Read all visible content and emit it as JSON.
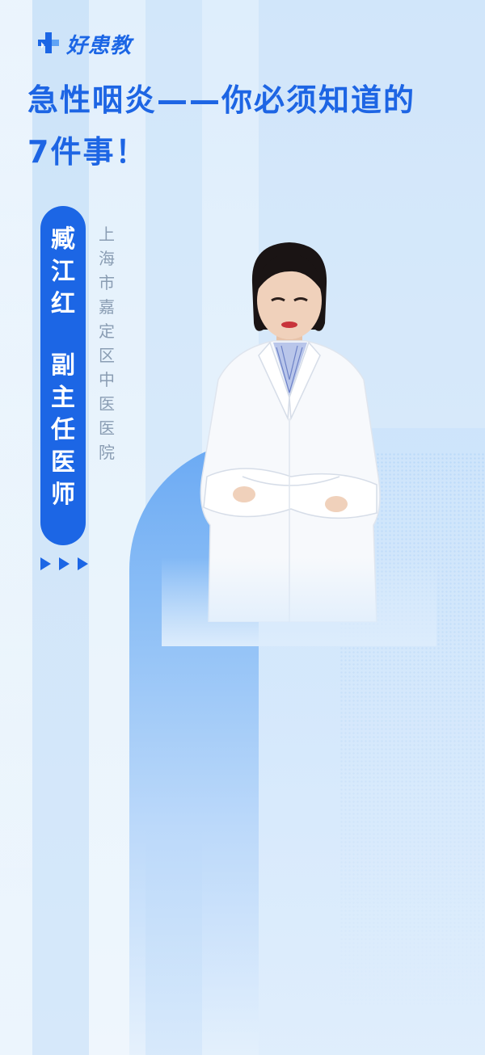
{
  "brand": {
    "logo_text": "好患教",
    "icon": "medical-cross-logo-icon",
    "color": "#1c66e5"
  },
  "title": {
    "line1": "急性咽炎——你必须知道的",
    "line2": "7件事！"
  },
  "doctor": {
    "name_chars": [
      "臧",
      "江",
      "红"
    ],
    "role_chars": [
      "副",
      "主",
      "任",
      "医",
      "师"
    ],
    "hospital_chars": [
      "上",
      "海",
      "市",
      "嘉",
      "定",
      "区",
      "中",
      "医",
      "医",
      "院"
    ],
    "photo": "doctor-portrait"
  },
  "decor": {
    "arrow_icons": [
      "play-arrow-icon",
      "play-arrow-icon",
      "play-arrow-icon"
    ]
  },
  "colors": {
    "accent": "#1c66e5",
    "background": "#dcedfb",
    "muted_text": "#8a9db3"
  }
}
